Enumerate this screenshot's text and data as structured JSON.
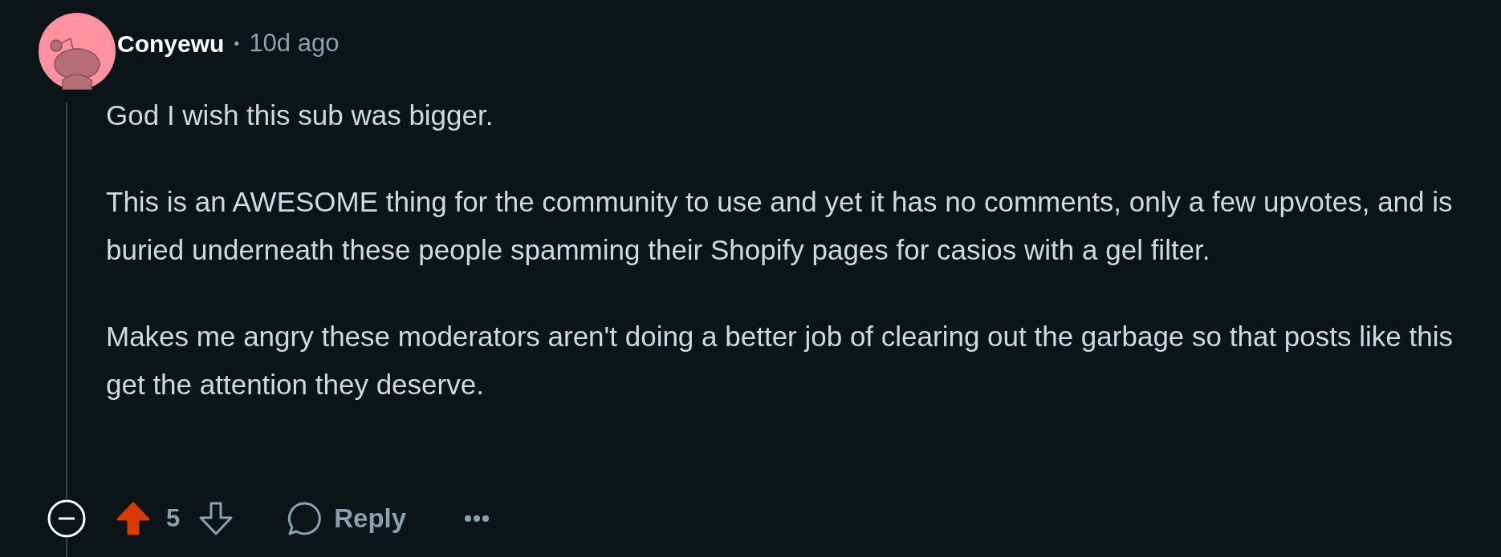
{
  "comment": {
    "author": "Conyewu",
    "separator": "•",
    "time": "10d ago",
    "paragraphs": [
      "God I wish this sub was bigger.",
      "This is an AWESOME thing for the community to use and yet it has no comments, only a few upvotes, and is buried underneath these people spamming their Shopify pages for casios with a gel filter.",
      "Makes me angry these moderators aren't doing a better job of clearing out the garbage so that posts like this get the attention they deserve."
    ],
    "upvoted": true,
    "score": "5",
    "reply_label": "Reply"
  }
}
